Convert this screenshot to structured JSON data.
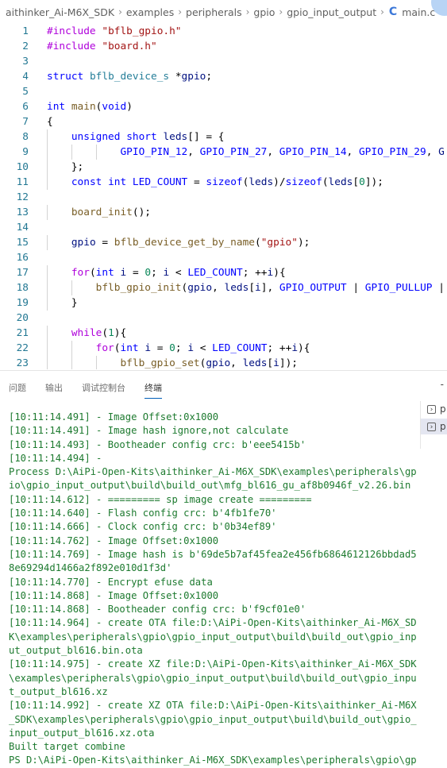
{
  "breadcrumb": {
    "items": [
      "aithinker_Ai-M6X_SDK",
      "examples",
      "peripherals",
      "gpio",
      "gpio_input_output"
    ],
    "file_icon": "C",
    "file": "main.c",
    "more": "…"
  },
  "editor": {
    "lines": [
      {
        "n": "1",
        "text": "#include \"bflb_gpio.h\""
      },
      {
        "n": "2",
        "text": "#include \"board.h\""
      },
      {
        "n": "3",
        "text": ""
      },
      {
        "n": "4",
        "text": "struct bflb_device_s *gpio;"
      },
      {
        "n": "5",
        "text": ""
      },
      {
        "n": "6",
        "text": "int main(void)"
      },
      {
        "n": "7",
        "text": "{"
      },
      {
        "n": "8",
        "text": "    unsigned short leds[] = {"
      },
      {
        "n": "9",
        "text": "            GPIO_PIN_12, GPIO_PIN_27, GPIO_PIN_14, GPIO_PIN_29, G"
      },
      {
        "n": "10",
        "text": "    };"
      },
      {
        "n": "11",
        "text": "    const int LED_COUNT = sizeof(leds)/sizeof(leds[0]);"
      },
      {
        "n": "12",
        "text": ""
      },
      {
        "n": "13",
        "text": "    board_init();"
      },
      {
        "n": "14",
        "text": ""
      },
      {
        "n": "15",
        "text": "    gpio = bflb_device_get_by_name(\"gpio\");"
      },
      {
        "n": "16",
        "text": ""
      },
      {
        "n": "17",
        "text": "    for(int i = 0; i < LED_COUNT; ++i){"
      },
      {
        "n": "18",
        "text": "        bflb_gpio_init(gpio, leds[i], GPIO_OUTPUT | GPIO_PULLUP |"
      },
      {
        "n": "19",
        "text": "    }"
      },
      {
        "n": "20",
        "text": ""
      },
      {
        "n": "21",
        "text": "    while(1){"
      },
      {
        "n": "22",
        "text": "        for(int i = 0; i < LED_COUNT; ++i){"
      },
      {
        "n": "23",
        "text": "            bflb_gpio_set(gpio, leds[i]);"
      }
    ]
  },
  "panel": {
    "tabs": [
      "问题",
      "输出",
      "调试控制台",
      "终端"
    ],
    "active_tab": "终端",
    "more": "-",
    "terminal_items": [
      "p",
      "p"
    ],
    "terminal_lines": [
      "[10:11:14.491] - Image Offset:0x1000",
      "[10:11:14.491] - Image hash ignore,not calculate",
      "[10:11:14.493] - Bootheader config crc: b'eee5415b'",
      "[10:11:14.494] -",
      "Process D:\\AiPi-Open-Kits\\aithinker_Ai-M6X_SDK\\examples\\peripherals\\gp",
      "io\\gpio_input_output\\build\\build_out\\mfg_bl616_gu_af8b0946f_v2.26.bin",
      "[10:11:14.612] - ========= sp image create =========",
      "[10:11:14.640] - Flash config crc: b'4fb1fe70'",
      "[10:11:14.666] - Clock config crc: b'0b34ef89'",
      "[10:11:14.762] - Image Offset:0x1000",
      "[10:11:14.769] - Image hash is b'69de5b7af45fea2e456fb6864612126bbdad5",
      "8e69294d1466a2f892e010d1f3d'",
      "[10:11:14.770] - Encrypt efuse data",
      "[10:11:14.868] - Image Offset:0x1000",
      "[10:11:14.868] - Bootheader config crc: b'f9cf01e0'",
      "[10:11:14.964] - create OTA file:D:\\AiPi-Open-Kits\\aithinker_Ai-M6X_SD",
      "K\\examples\\peripherals\\gpio\\gpio_input_output\\build\\build_out\\gpio_inp",
      "ut_output_bl616.bin.ota",
      "[10:11:14.975] - create XZ file:D:\\AiPi-Open-Kits\\aithinker_Ai-M6X_SDK",
      "\\examples\\peripherals\\gpio\\gpio_input_output\\build\\build_out\\gpio_inpu",
      "t_output_bl616.xz",
      "[10:11:14.992] - create XZ OTA file:D:\\AiPi-Open-Kits\\aithinker_Ai-M6X",
      "_SDK\\examples\\peripherals\\gpio\\gpio_input_output\\build\\build_out\\gpio_",
      "input_output_bl616.xz.ota",
      "Built target combine",
      "PS D:\\AiPi-Open-Kits\\aithinker_Ai-M6X_SDK\\examples\\peripherals\\gpio\\gp"
    ]
  },
  "colors": {
    "terminal_text": "#1d7a2f",
    "line_number": "#237893",
    "keyword": "#0000ff",
    "string": "#a31515",
    "function": "#795e26",
    "accent": "#005fb8"
  }
}
